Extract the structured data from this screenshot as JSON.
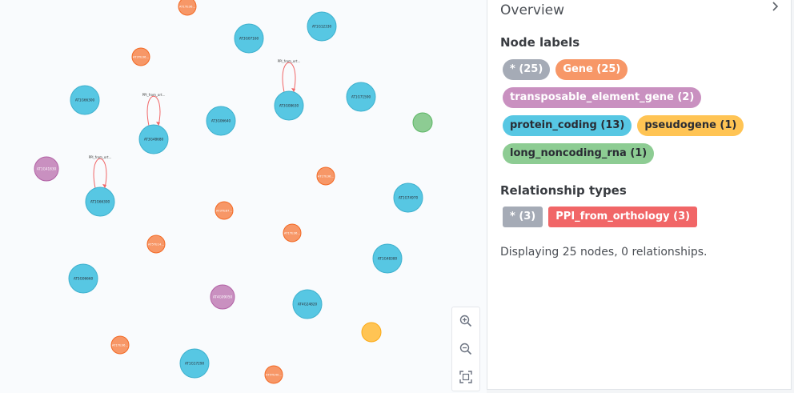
{
  "overview": {
    "title": "Overview",
    "node_labels_title": "Node labels",
    "relationship_types_title": "Relationship types",
    "node_labels": [
      {
        "label": "* (25)",
        "color": "#a5abb6",
        "text_color": "#ffffff"
      },
      {
        "label": "Gene (25)",
        "color": "#f79767",
        "text_color": "#ffffff"
      },
      {
        "label": "transposable_element_gene (2)",
        "color": "#c990c0",
        "text_color": "#ffffff"
      },
      {
        "label": "protein_coding (13)",
        "color": "#57c7e3",
        "text_color": "#2a2c34"
      },
      {
        "label": "pseudogene (1)",
        "color": "#ffc454",
        "text_color": "#2a2c34"
      },
      {
        "label": "long_noncoding_rna (1)",
        "color": "#8dcc93",
        "text_color": "#2a2c34"
      }
    ],
    "relationship_types": [
      {
        "label": "* (3)",
        "color": "#a5abb6",
        "text_color": "#ffffff"
      },
      {
        "label": "PPI_from_orthology (3)",
        "color": "#f16667",
        "text_color": "#ffffff"
      }
    ],
    "status": "Displaying 25 nodes, 0 relationships."
  },
  "graph": {
    "colors": {
      "protein_coding": "#57c7e3",
      "gene": "#f79767",
      "transposable_element_gene": "#c990c0",
      "pseudogene": "#ffc454",
      "long_noncoding_rna": "#8dcc93",
      "relationship": "#f16667"
    },
    "nodes": [
      {
        "id": "n1",
        "type": "gene",
        "label": "AT1TE36..."
      },
      {
        "id": "n2",
        "type": "protein_coding",
        "label": "AT1G12330"
      },
      {
        "id": "n3",
        "type": "protein_coding",
        "label": "AT3G07160"
      },
      {
        "id": "n4",
        "type": "gene",
        "label": "AT3TE36..."
      },
      {
        "id": "n5",
        "type": "protein_coding",
        "label": "AT1G66300"
      },
      {
        "id": "n6",
        "type": "protein_coding",
        "label": "AT1G71590"
      },
      {
        "id": "n7",
        "type": "protein_coding",
        "label": "AT3G06640"
      },
      {
        "id": "n8",
        "type": "long_noncoding_rna",
        "label": ""
      },
      {
        "id": "n9",
        "type": "protein_coding",
        "label": "AT3G08630"
      },
      {
        "id": "n10",
        "type": "protein_coding",
        "label": "AT3G48680"
      },
      {
        "id": "n11",
        "type": "transposable_element_gene",
        "label": "AT1G41830"
      },
      {
        "id": "n12",
        "type": "gene",
        "label": "AT1TE36..."
      },
      {
        "id": "n13",
        "type": "protein_coding",
        "label": "AT1G66300"
      },
      {
        "id": "n14",
        "type": "protein_coding",
        "label": "AT1G74970"
      },
      {
        "id": "n15",
        "type": "gene",
        "label": "AT3TE87..."
      },
      {
        "id": "n16",
        "type": "gene",
        "label": "AT1TE36..."
      },
      {
        "id": "n17",
        "type": "gene",
        "label": "AT5TE14..."
      },
      {
        "id": "n18",
        "type": "protein_coding",
        "label": "AT1G48380"
      },
      {
        "id": "n19",
        "type": "protein_coding",
        "label": "AT5G06660"
      },
      {
        "id": "n20",
        "type": "transposable_element_gene",
        "label": "AT4G09050"
      },
      {
        "id": "n21",
        "type": "protein_coding",
        "label": "AT4G24820"
      },
      {
        "id": "n22",
        "type": "pseudogene",
        "label": ""
      },
      {
        "id": "n23",
        "type": "gene",
        "label": "AT1TE36..."
      },
      {
        "id": "n24",
        "type": "protein_coding",
        "label": "AT1G17290"
      },
      {
        "id": "n25",
        "type": "gene",
        "label": "AT5TE40..."
      }
    ],
    "self_loops": [
      {
        "node": "n9",
        "label": "PPI_from_ort..."
      },
      {
        "node": "n10",
        "label": "PPI_from_ort..."
      },
      {
        "node": "n13",
        "label": "PPI_from_ort..."
      }
    ]
  }
}
